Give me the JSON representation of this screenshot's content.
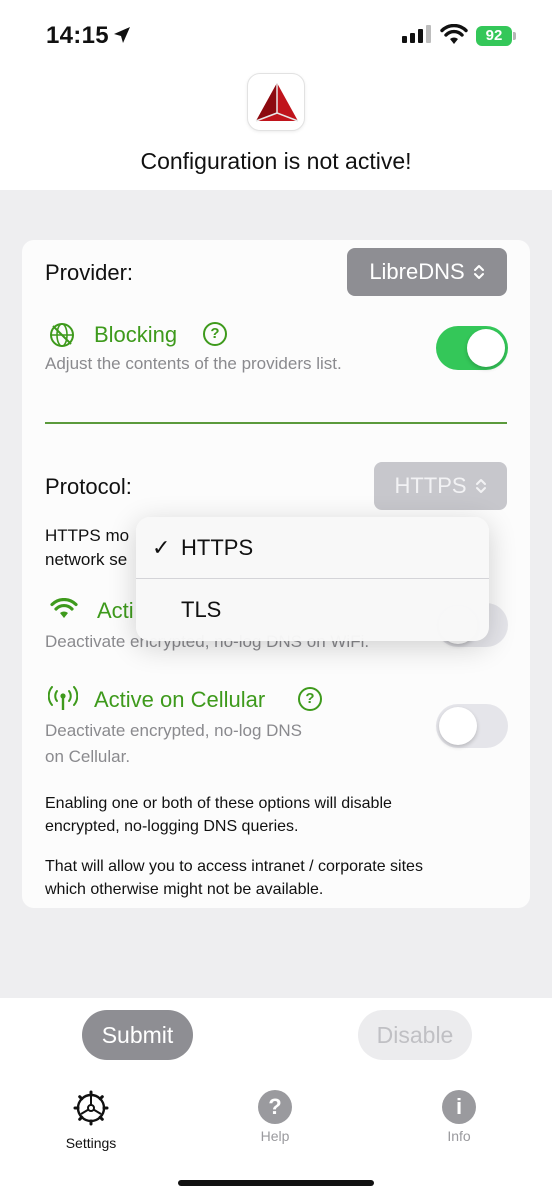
{
  "status_bar": {
    "time": "14:15",
    "battery": "92",
    "battery_color": "#34c759"
  },
  "header": {
    "app_icon": "triangle-logo-icon",
    "title": "Configuration is not active!"
  },
  "settings": {
    "provider": {
      "label": "Provider:",
      "value": "LibreDNS"
    },
    "blocking": {
      "icon": "globe-block-icon",
      "title": "Blocking",
      "help": "?",
      "description": "Adjust the contents of the providers list.",
      "enabled": true
    },
    "protocol": {
      "label": "Protocol:",
      "value": "HTTPS",
      "description_lines": [
        "HTTPS mo",
        "network se"
      ]
    },
    "wifi": {
      "icon": "wifi-icon",
      "title": "Acti",
      "description": "Deactivate  encrypted, no-log DNS on WiFi.",
      "enabled": false
    },
    "cellular": {
      "icon": "antenna-icon",
      "title": "Active on Cellular",
      "help": "?",
      "description_lines": [
        "Deactivate encrypted, no-log DNS",
        "on Cellular."
      ],
      "enabled": false
    },
    "notes": [
      [
        "Enabling one or both of these options will disable",
        "encrypted, no-logging DNS queries."
      ],
      [
        "That will allow you to access intranet / corporate sites",
        "which otherwise might not be available."
      ]
    ]
  },
  "protocol_menu": {
    "options": [
      {
        "label": "HTTPS",
        "checked": "✓"
      },
      {
        "label": "TLS",
        "checked": ""
      }
    ]
  },
  "actions": {
    "submit": "Submit",
    "disable": "Disable"
  },
  "tabs": [
    {
      "label": "Settings",
      "icon": "gear-icon",
      "active": true
    },
    {
      "label": "Help",
      "icon": "question-icon",
      "glyph": "?"
    },
    {
      "label": "Info",
      "icon": "info-icon",
      "glyph": "i"
    }
  ],
  "colors": {
    "accent_green": "#3e9a1c",
    "toggle_on": "#34c759",
    "button_grey": "#8e8e93",
    "brand_red": "#c0141c"
  }
}
